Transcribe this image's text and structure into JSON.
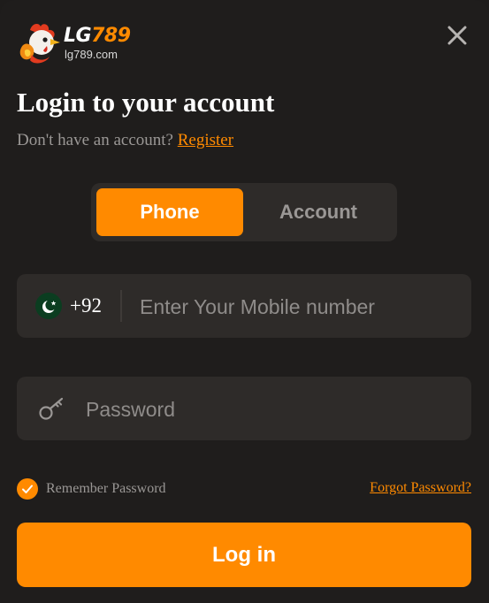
{
  "brand": {
    "word_lg": "LG",
    "word_num": "789",
    "domain": "lg789.com",
    "accent_color": "#ff8a00"
  },
  "icons": {
    "close": "close-icon",
    "logo": "rooster-logo-icon",
    "flag": "pakistan-flag-icon",
    "password": "key-icon",
    "remember": "checkmark-icon"
  },
  "header": {
    "title": "Login to your account",
    "subtitle": "Don't have an account?",
    "register_link": "Register"
  },
  "tabs": [
    {
      "label": "Phone",
      "active": true
    },
    {
      "label": "Account",
      "active": false
    }
  ],
  "phone_field": {
    "country_code": "+92",
    "value": "",
    "placeholder": "Enter Your Mobile number"
  },
  "password_field": {
    "value": "",
    "placeholder": "Password"
  },
  "remember": {
    "label": "Remember Password",
    "checked": true
  },
  "forgot_link": "Forgot Password?",
  "login_button": "Log in"
}
